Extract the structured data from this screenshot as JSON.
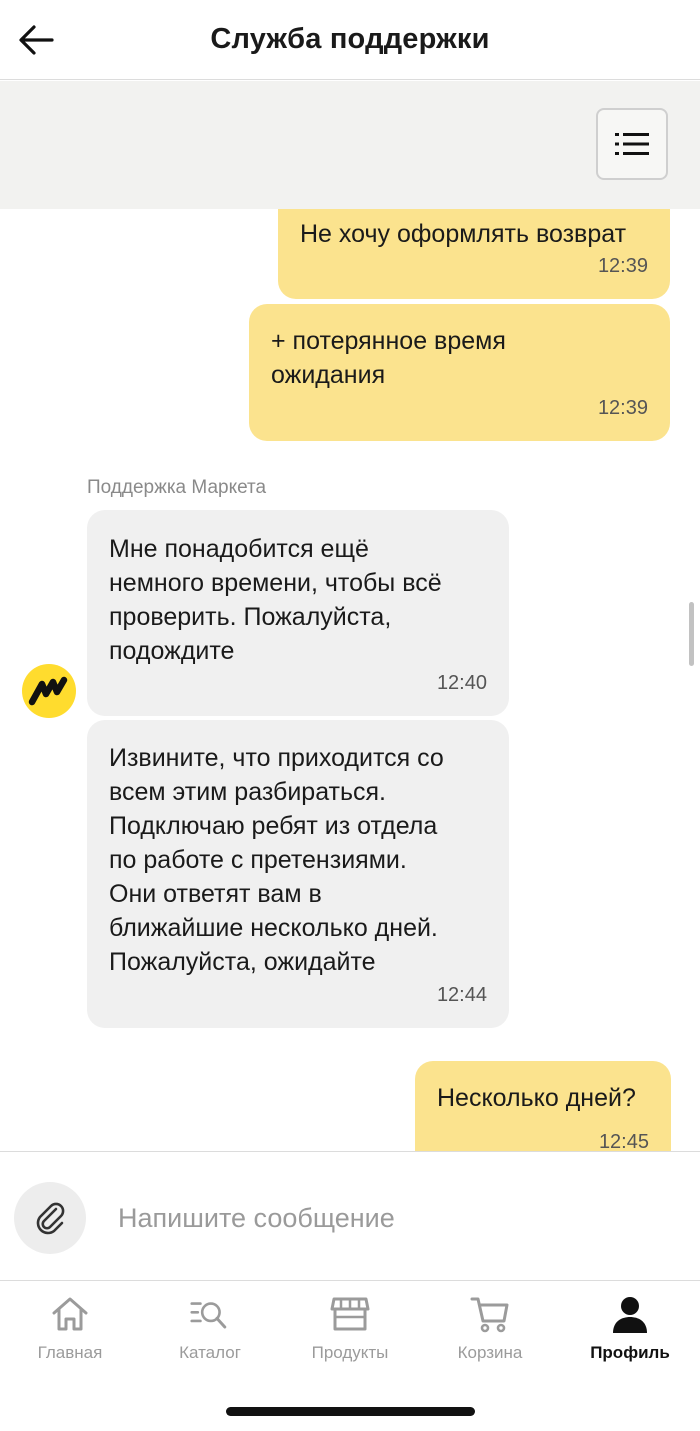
{
  "header": {
    "title": "Служба поддержки"
  },
  "chat": {
    "sender_name": "Поддержка Маркета",
    "messages": [
      {
        "text": "Не хочу оформлять возврат",
        "time": "12:39"
      },
      {
        "text": "+ потерянное время\nожидания",
        "time": "12:39"
      },
      {
        "text": "Мне понадобится ещё\nнемного времени, чтобы всё\nпроверить. Пожалуйста,\nподождите",
        "time": "12:40"
      },
      {
        "text": "Извините, что приходится со\nвсем этим разбираться.\nПодключаю ребят из отдела\nпо работе с претензиями.\nОни ответят вам в\nближайшие несколько дней.\nПожалуйста, ожидайте",
        "time": "12:44"
      },
      {
        "text": "Несколько дней?",
        "time": "12:45"
      }
    ]
  },
  "composer": {
    "placeholder": "Напишите сообщение"
  },
  "tabbar": {
    "items": [
      {
        "label": "Главная"
      },
      {
        "label": "Каталог"
      },
      {
        "label": "Продукты"
      },
      {
        "label": "Корзина"
      },
      {
        "label": "Профиль"
      }
    ]
  },
  "colors": {
    "outgoing": "#fbe38e",
    "incoming": "#f0f0f0",
    "brand": "#ffdc2e"
  }
}
